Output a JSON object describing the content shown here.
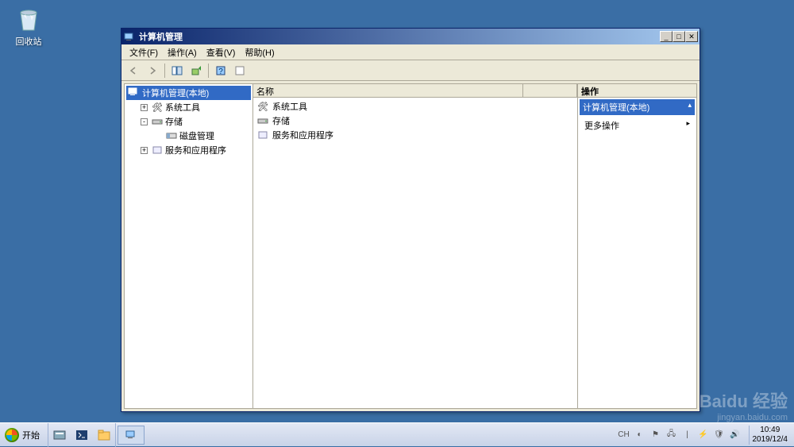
{
  "desktop": {
    "recycle_bin": "回收站"
  },
  "window": {
    "title": "计算机管理",
    "menu": {
      "file": "文件(F)",
      "action": "操作(A)",
      "view": "查看(V)",
      "help": "帮助(H)"
    },
    "tree": {
      "root": "计算机管理(本地)",
      "items": [
        {
          "exp": "+",
          "label": "系统工具"
        },
        {
          "exp": "-",
          "label": "存储"
        },
        {
          "exp": "",
          "label": "磁盘管理",
          "indent": 2
        },
        {
          "exp": "+",
          "label": "服务和应用程序"
        }
      ]
    },
    "list": {
      "header": "名称",
      "rows": [
        {
          "label": "系统工具"
        },
        {
          "label": "存储"
        },
        {
          "label": "服务和应用程序"
        }
      ]
    },
    "actions": {
      "header": "操作",
      "title": "计算机管理(本地)",
      "more": "更多操作"
    }
  },
  "taskbar": {
    "start": "开始",
    "lang": "CH",
    "time": "10:49",
    "date": "2019/12/4"
  },
  "watermark": {
    "brand": "Baidu 经验",
    "sub": "jingyan.baidu.com"
  }
}
